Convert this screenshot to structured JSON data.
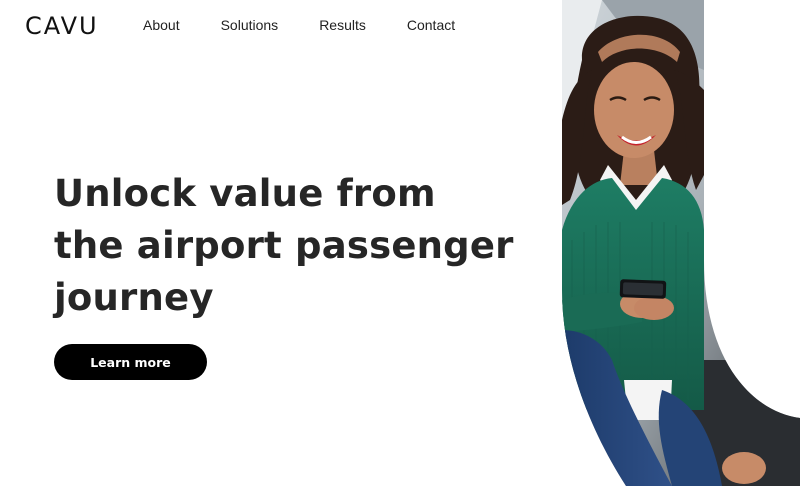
{
  "brand": {
    "logo_text": "CAVU"
  },
  "nav": {
    "items": [
      {
        "label": "About"
      },
      {
        "label": "Solutions"
      },
      {
        "label": "Results"
      },
      {
        "label": "Contact"
      }
    ]
  },
  "hero": {
    "title": "Unlock value from the airport passenger journey",
    "cta_label": "Learn more",
    "image": {
      "subject": "woman-smiling-at-phone",
      "colors": {
        "sweater": "#1f7a62",
        "jeans": "#2a4a7a",
        "background": "#ffffff"
      }
    }
  },
  "colors": {
    "text": "#262626",
    "cta_bg": "#000000",
    "cta_text": "#ffffff",
    "page_bg": "#ffffff"
  }
}
